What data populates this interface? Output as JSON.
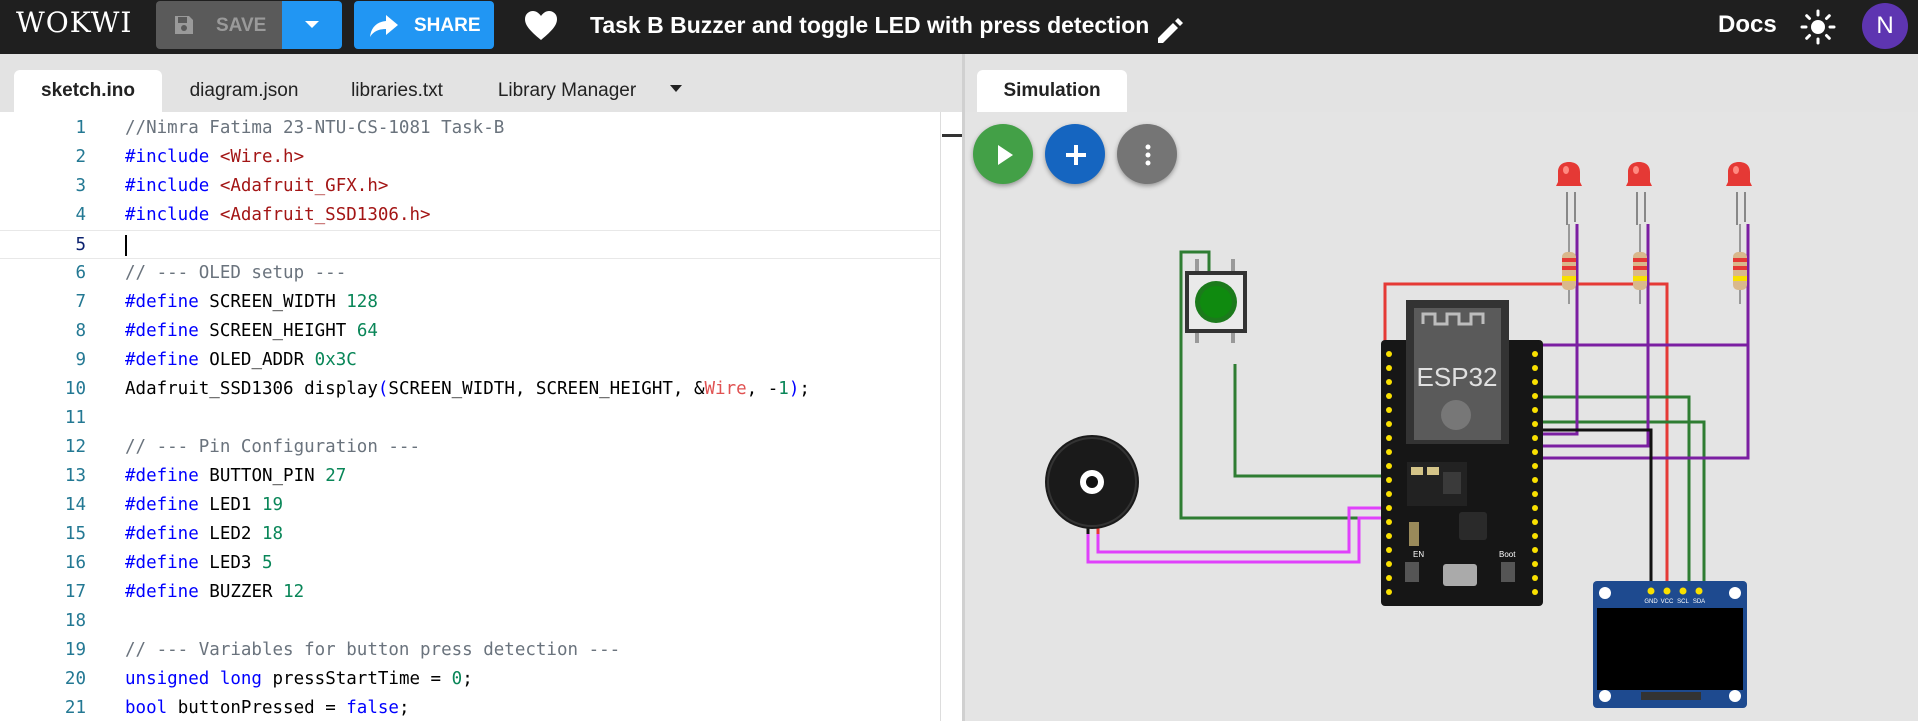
{
  "app": {
    "logo": "WOKWI"
  },
  "toolbar": {
    "save_label": "SAVE",
    "share_label": "SHARE",
    "project_title": "Task B Buzzer and toggle LED with press detection",
    "docs_label": "Docs",
    "avatar_initial": "N"
  },
  "editor": {
    "tabs": [
      {
        "label": "sketch.ino",
        "active": true
      },
      {
        "label": "diagram.json",
        "active": false
      },
      {
        "label": "libraries.txt",
        "active": false
      },
      {
        "label": "Library Manager",
        "active": false
      }
    ],
    "current_line": 5,
    "lines": [
      {
        "n": "1",
        "segs": [
          [
            "c-com",
            "//Nimra Fatima 23-NTU-CS-1081 Task-B"
          ]
        ]
      },
      {
        "n": "2",
        "segs": [
          [
            "c-kw",
            "#include "
          ],
          [
            "c-str",
            "<Wire.h>"
          ]
        ]
      },
      {
        "n": "3",
        "segs": [
          [
            "c-kw",
            "#include "
          ],
          [
            "c-str",
            "<Adafruit_GFX.h>"
          ]
        ]
      },
      {
        "n": "4",
        "segs": [
          [
            "c-kw",
            "#include "
          ],
          [
            "c-str",
            "<Adafruit_SSD1306.h>"
          ]
        ]
      },
      {
        "n": "5",
        "segs": []
      },
      {
        "n": "6",
        "segs": [
          [
            "c-com",
            "// --- OLED setup ---"
          ]
        ]
      },
      {
        "n": "7",
        "segs": [
          [
            "c-kw",
            "#define "
          ],
          [
            "",
            "SCREEN_WIDTH "
          ],
          [
            "c-num",
            "128"
          ]
        ]
      },
      {
        "n": "8",
        "segs": [
          [
            "c-kw",
            "#define "
          ],
          [
            "",
            "SCREEN_HEIGHT "
          ],
          [
            "c-num",
            "64"
          ]
        ]
      },
      {
        "n": "9",
        "segs": [
          [
            "c-kw",
            "#define "
          ],
          [
            "",
            "OLED_ADDR "
          ],
          [
            "c-num",
            "0x3C"
          ]
        ]
      },
      {
        "n": "10",
        "segs": [
          [
            "",
            "Adafruit_SSD1306 display"
          ],
          [
            "c-kw",
            "("
          ],
          [
            "",
            "SCREEN_WIDTH, SCREEN_HEIGHT, &"
          ],
          [
            "c-red",
            "Wire"
          ],
          [
            "",
            ", -"
          ],
          [
            "c-num",
            "1"
          ],
          [
            "c-kw",
            ")"
          ],
          [
            "",
            ";"
          ]
        ]
      },
      {
        "n": "11",
        "segs": []
      },
      {
        "n": "12",
        "segs": [
          [
            "c-com",
            "// --- Pin Configuration ---"
          ]
        ]
      },
      {
        "n": "13",
        "segs": [
          [
            "c-kw",
            "#define "
          ],
          [
            "",
            "BUTTON_PIN "
          ],
          [
            "c-num",
            "27"
          ]
        ]
      },
      {
        "n": "14",
        "segs": [
          [
            "c-kw",
            "#define "
          ],
          [
            "",
            "LED1 "
          ],
          [
            "c-num",
            "19"
          ]
        ]
      },
      {
        "n": "15",
        "segs": [
          [
            "c-kw",
            "#define "
          ],
          [
            "",
            "LED2 "
          ],
          [
            "c-num",
            "18"
          ]
        ]
      },
      {
        "n": "16",
        "segs": [
          [
            "c-kw",
            "#define "
          ],
          [
            "",
            "LED3 "
          ],
          [
            "c-num",
            "5"
          ]
        ]
      },
      {
        "n": "17",
        "segs": [
          [
            "c-kw",
            "#define "
          ],
          [
            "",
            "BUZZER "
          ],
          [
            "c-num",
            "12"
          ]
        ]
      },
      {
        "n": "18",
        "segs": []
      },
      {
        "n": "19",
        "segs": [
          [
            "c-com",
            "// --- Variables for button press detection ---"
          ]
        ]
      },
      {
        "n": "20",
        "segs": [
          [
            "c-kw",
            "unsigned long "
          ],
          [
            "",
            "pressStartTime = "
          ],
          [
            "c-num",
            "0"
          ],
          [
            "",
            ";"
          ]
        ]
      },
      {
        "n": "21",
        "segs": [
          [
            "c-kw",
            "bool "
          ],
          [
            "",
            "buttonPressed = "
          ],
          [
            "c-kw",
            "false"
          ],
          [
            "",
            ";"
          ]
        ]
      }
    ]
  },
  "simulation": {
    "tab_label": "Simulation",
    "esp32_label": "ESP32",
    "oled_pins": [
      "GND",
      "VCC",
      "SCL",
      "SDA"
    ],
    "board_labels": {
      "en": "EN",
      "boot": "Boot"
    },
    "colors": {
      "play": "#43a047",
      "add": "#1565c0",
      "more": "#757575",
      "wire_red": "#e53935",
      "wire_green": "#2e7d32",
      "wire_purple": "#7b1fa2",
      "wire_pink": "#e040fb",
      "wire_black": "#111111"
    }
  }
}
